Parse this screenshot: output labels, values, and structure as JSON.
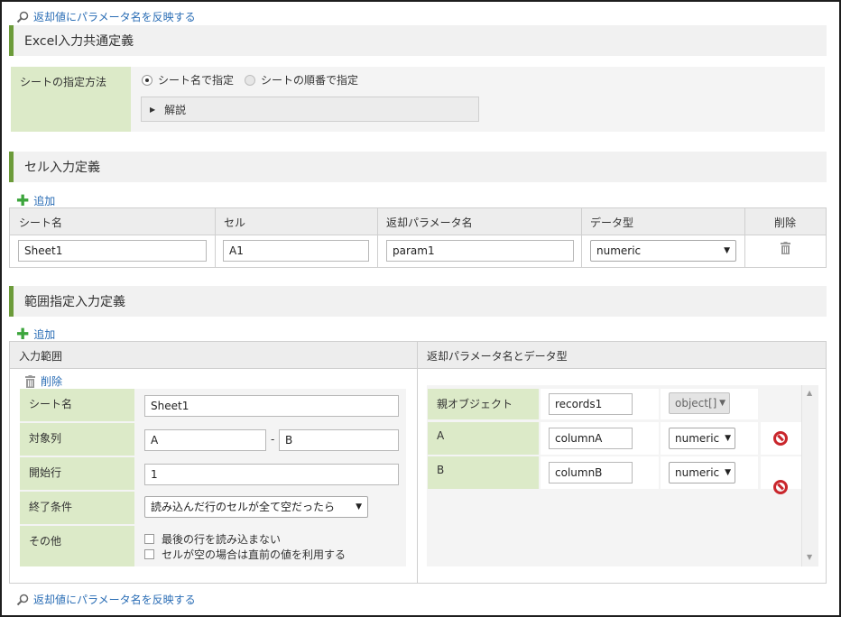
{
  "reflect_link": "返却値にパラメータ名を反映する",
  "excel_section": {
    "title": "Excel入力共通定義",
    "sheet_spec_label": "シートの指定方法",
    "radio_by_name": "シート名で指定",
    "radio_by_order": "シートの順番で指定",
    "explanation": "解説"
  },
  "cell_section": {
    "title": "セル入力定義",
    "add": "追加",
    "columns": [
      "シート名",
      "セル",
      "返却パラメータ名",
      "データ型",
      "削除"
    ],
    "row": {
      "sheet": "Sheet1",
      "cell": "A1",
      "param": "param1",
      "type": "numeric"
    }
  },
  "range_section": {
    "title": "範囲指定入力定義",
    "add": "追加",
    "input_range_header": "入力範囲",
    "return_header": "返却パラメータ名とデータ型",
    "delete": "削除",
    "sheet_label": "シート名",
    "sheet_value": "Sheet1",
    "target_col_label": "対象列",
    "col_from": "A",
    "col_sep": "-",
    "col_to": "B",
    "start_row_label": "開始行",
    "start_row_value": "1",
    "end_cond_label": "終了条件",
    "end_cond_value": "読み込んだ行のセルが全て空だったら",
    "other_label": "その他",
    "opt1": "最後の行を読み込まない",
    "opt2": "セルが空の場合は直前の値を利用する",
    "params": [
      {
        "label": "親オブジェクト",
        "name": "records1",
        "type": "object[]"
      },
      {
        "label": "A",
        "name": "columnA",
        "type": "numeric"
      },
      {
        "label": "B",
        "name": "columnB",
        "type": "numeric"
      }
    ]
  }
}
